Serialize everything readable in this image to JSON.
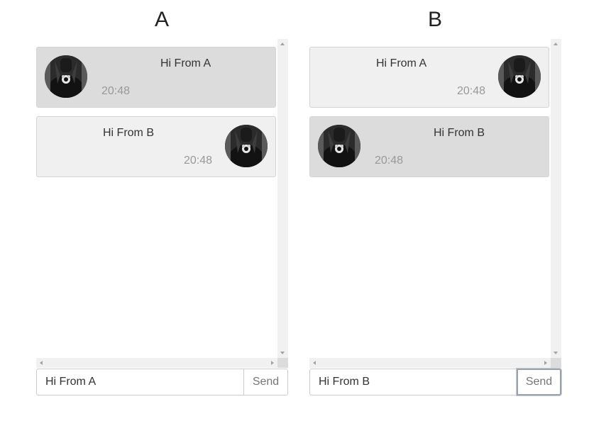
{
  "panels": [
    {
      "title": "A",
      "messages": [
        {
          "text": "Hi From A",
          "time": "20:48",
          "sender": "A"
        },
        {
          "text": "Hi From B",
          "time": "20:48",
          "sender": "B"
        }
      ],
      "input": {
        "value": "Hi From A"
      },
      "send_label": "Send"
    },
    {
      "title": "B",
      "messages": [
        {
          "text": "Hi From A",
          "time": "20:48",
          "sender": "A"
        },
        {
          "text": "Hi From B",
          "time": "20:48",
          "sender": "B"
        }
      ],
      "input": {
        "value": "Hi From B"
      },
      "send_label": "Send"
    }
  ],
  "icons": {
    "avatar": "user-avatar-photo"
  },
  "colors": {
    "own_message_bg": "#dcdcdc",
    "other_message_bg": "#f0f0f0",
    "timestamp": "#999999",
    "border": "#d4d4d4"
  }
}
